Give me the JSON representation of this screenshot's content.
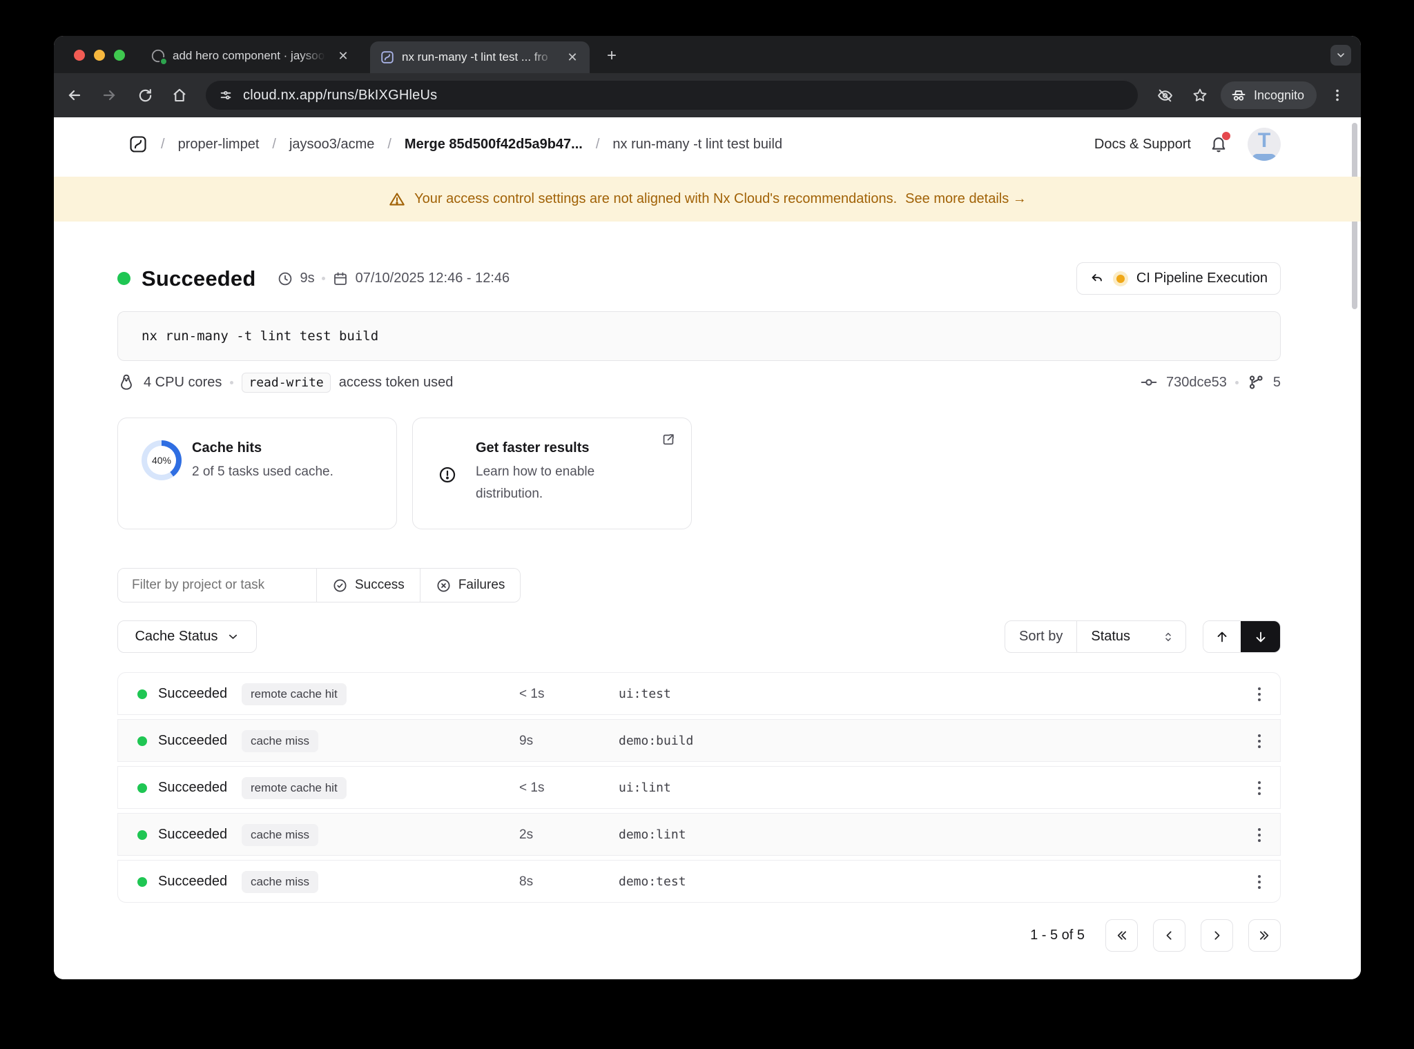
{
  "browser": {
    "tab1": {
      "title": "add hero component · jaysoo"
    },
    "tab2": {
      "title": "nx run-many -t lint test ... fro"
    },
    "url": "cloud.nx.app/runs/BkIXGHleUs",
    "incognito": "Incognito"
  },
  "header": {
    "sep": "/",
    "crumbs": [
      "proper-limpet",
      "jaysoo3/acme",
      "Merge 85d500f42d5a9b47...",
      "nx run-many -t lint test build"
    ],
    "docs": "Docs & Support",
    "avatar": "T"
  },
  "banner": {
    "text": "Your access control settings are not aligned with Nx Cloud's recommendations.",
    "link": "See more details →"
  },
  "run": {
    "status": "Succeeded",
    "duration": "9s",
    "datetime": "07/10/2025 12:46 - 12:46",
    "pipeline": "CI Pipeline Execution",
    "command": "nx run-many -t lint test build",
    "cpu": "4 CPU cores",
    "token": "read-write",
    "token_text": "access token used",
    "commit": "730dce53",
    "vcs_count": "5"
  },
  "cards": {
    "cache": {
      "percent": "40%",
      "title": "Cache hits",
      "subtitle": "2 of 5 tasks used cache."
    },
    "faster": {
      "title": "Get faster results",
      "line1": "Learn how to enable",
      "line2": "distribution."
    }
  },
  "filters": {
    "placeholder": "Filter by project or task",
    "success": "Success",
    "failures": "Failures"
  },
  "sort": {
    "cache_status": "Cache Status",
    "sort_by": "Sort by",
    "value": "Status"
  },
  "table": {
    "rows": [
      {
        "status": "Succeeded",
        "badge": "remote cache hit",
        "duration": "< 1s",
        "task": "ui:test"
      },
      {
        "status": "Succeeded",
        "badge": "cache miss",
        "duration": "9s",
        "task": "demo:build"
      },
      {
        "status": "Succeeded",
        "badge": "remote cache hit",
        "duration": "< 1s",
        "task": "ui:lint"
      },
      {
        "status": "Succeeded",
        "badge": "cache miss",
        "duration": "2s",
        "task": "demo:lint"
      },
      {
        "status": "Succeeded",
        "badge": "cache miss",
        "duration": "8s",
        "task": "demo:test"
      }
    ]
  },
  "pagination": {
    "label": "1 - 5 of 5"
  },
  "colors": {
    "success_green": "#1fc653",
    "accent_blue": "#2f6ee2",
    "warning_text": "#a16207",
    "banner_bg": "#fcf3da",
    "run_type_yellow": "#f0a818"
  }
}
